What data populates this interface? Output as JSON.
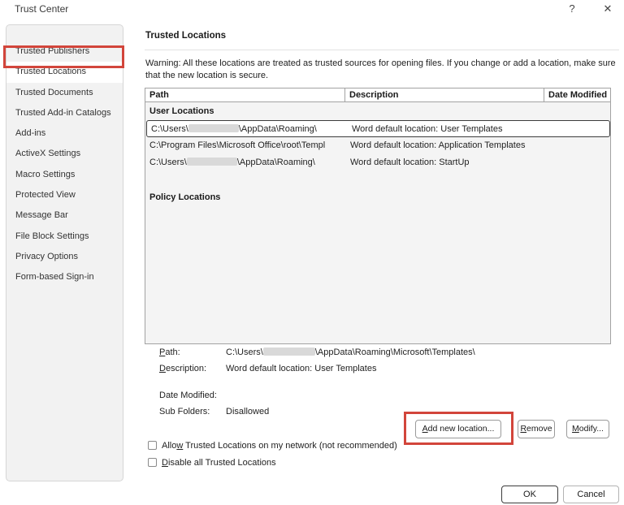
{
  "window": {
    "title": "Trust Center",
    "help_icon": "?",
    "close_icon": "✕"
  },
  "colors": {
    "annotation_red": "#d2453b",
    "selected_row_border": "#3c3c3c",
    "sidebar_bg": "#f2f2f2"
  },
  "sidebar": {
    "items": [
      {
        "label": "Trusted Publishers",
        "selected": false
      },
      {
        "label": "Trusted Locations",
        "selected": true
      },
      {
        "label": "Trusted Documents",
        "selected": false
      },
      {
        "label": "Trusted Add-in Catalogs",
        "selected": false
      },
      {
        "label": "Add-ins",
        "selected": false
      },
      {
        "label": "ActiveX Settings",
        "selected": false
      },
      {
        "label": "Macro Settings",
        "selected": false
      },
      {
        "label": "Protected View",
        "selected": false
      },
      {
        "label": "Message Bar",
        "selected": false
      },
      {
        "label": "File Block Settings",
        "selected": false
      },
      {
        "label": "Privacy Options",
        "selected": false
      },
      {
        "label": "Form-based Sign-in",
        "selected": false
      }
    ]
  },
  "main": {
    "heading": "Trusted Locations",
    "warning": "Warning: All these locations are treated as trusted sources for opening files.  If you change or add a location, make sure that the new location is secure.",
    "table": {
      "columns": [
        "Path",
        "Description",
        "Date Modified"
      ],
      "group_user": "User Locations",
      "group_policy": "Policy Locations",
      "rows": [
        {
          "path_pre": "C:\\Users\\",
          "path_redacted": "redacted-username",
          "path_post": "\\AppData\\Roaming\\",
          "description": "Word default location: User Templates",
          "date_modified": "",
          "selected": true
        },
        {
          "path_pre": "C:\\Program Files\\Microsoft Office\\root\\Templ",
          "description": "Word default location: Application Templates",
          "date_modified": "",
          "selected": false
        },
        {
          "path_pre": "C:\\Users\\",
          "path_redacted": "redacted-username",
          "path_post": "\\AppData\\Roaming\\",
          "description": "Word default location: StartUp",
          "date_modified": "",
          "selected": false
        }
      ]
    },
    "details": {
      "path_label": {
        "key": "P",
        "post": "ath:"
      },
      "path_value_pre": "C:\\Users\\",
      "path_value_redacted": "redacted-username",
      "path_value_post": "\\AppData\\Roaming\\Microsoft\\Templates\\",
      "desc_label": {
        "key": "D",
        "post": "escription:"
      },
      "desc_value": "Word default location: User Templates",
      "date_label": "Date Modified:",
      "date_value": "",
      "sub_label": "Sub Folders:",
      "sub_value": "Disallowed"
    },
    "buttons": {
      "add": {
        "key": "A",
        "post": "dd new location..."
      },
      "remove": {
        "key": "R",
        "post": "emove"
      },
      "modify": {
        "key": "M",
        "post": "odify..."
      }
    },
    "checkboxes": [
      {
        "pre": "Allo",
        "key": "w",
        "post": " Trusted Locations on my network (not recommended)",
        "checked": false
      },
      {
        "pre": "",
        "key": "D",
        "post": "isable all Trusted Locations",
        "checked": false
      }
    ]
  },
  "footer": {
    "ok": "OK",
    "cancel": "Cancel"
  }
}
